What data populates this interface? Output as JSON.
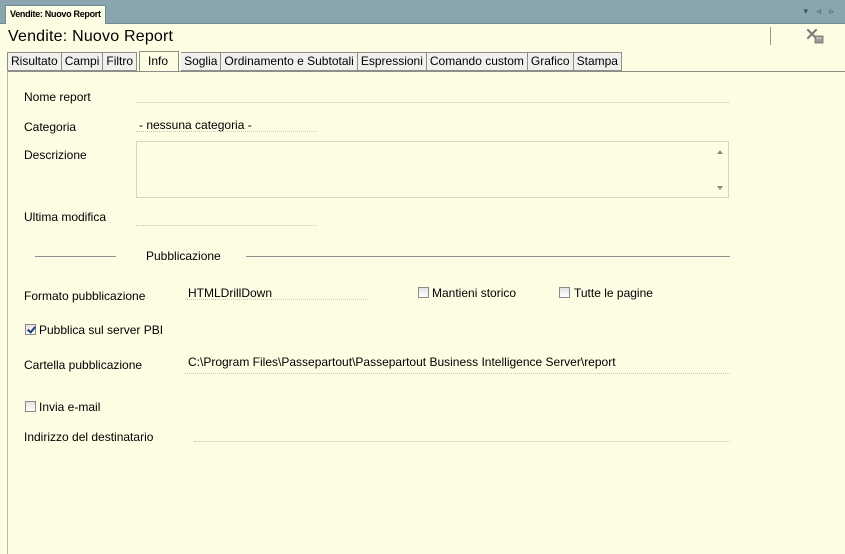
{
  "window": {
    "doc_tab": "Vendite: Nuovo Report",
    "title": "Vendite: Nuovo Report",
    "strip_controls": "▾ ◃ ▹"
  },
  "tabs": [
    {
      "label": "Risultato"
    },
    {
      "label": "Campi"
    },
    {
      "label": "Filtro"
    },
    {
      "label": "Info",
      "active": true
    },
    {
      "label": "Soglia"
    },
    {
      "label": "Ordinamento e Subtotali"
    },
    {
      "label": "Espressioni"
    },
    {
      "label": "Comando custom"
    },
    {
      "label": "Grafico"
    },
    {
      "label": "Stampa"
    }
  ],
  "form": {
    "nome_report_label": "Nome report",
    "nome_report_value": "",
    "categoria_label": "Categoria",
    "categoria_value": "- nessuna categoria -",
    "descrizione_label": "Descrizione",
    "descrizione_value": "",
    "ultima_modifica_label": "Ultima modifica",
    "ultima_modifica_value": ""
  },
  "pubblicazione": {
    "section_label": "Pubblicazione",
    "formato_label": "Formato pubblicazione",
    "formato_value": "HTMLDrillDown",
    "mantieni_storico_label": "Mantieni storico",
    "mantieni_storico_checked": false,
    "tutte_pagine_label": "Tutte le pagine",
    "tutte_pagine_checked": false,
    "pubblica_server_label": "Pubblica sul server PBI",
    "pubblica_server_checked": true,
    "cartella_label": "Cartella pubblicazione",
    "cartella_value": "C:\\Program Files\\Passepartout\\Passepartout Business Intelligence Server\\report",
    "invia_email_label": "Invia e-mail",
    "invia_email_checked": false,
    "destinatario_label": "Indirizzo del destinatario",
    "destinatario_value": ""
  },
  "colors": {
    "background": "#fdfde4",
    "strip": "#8aa5ad",
    "check_mark": "#1d3b7a"
  },
  "icons": {
    "close": "close-report-icon"
  }
}
